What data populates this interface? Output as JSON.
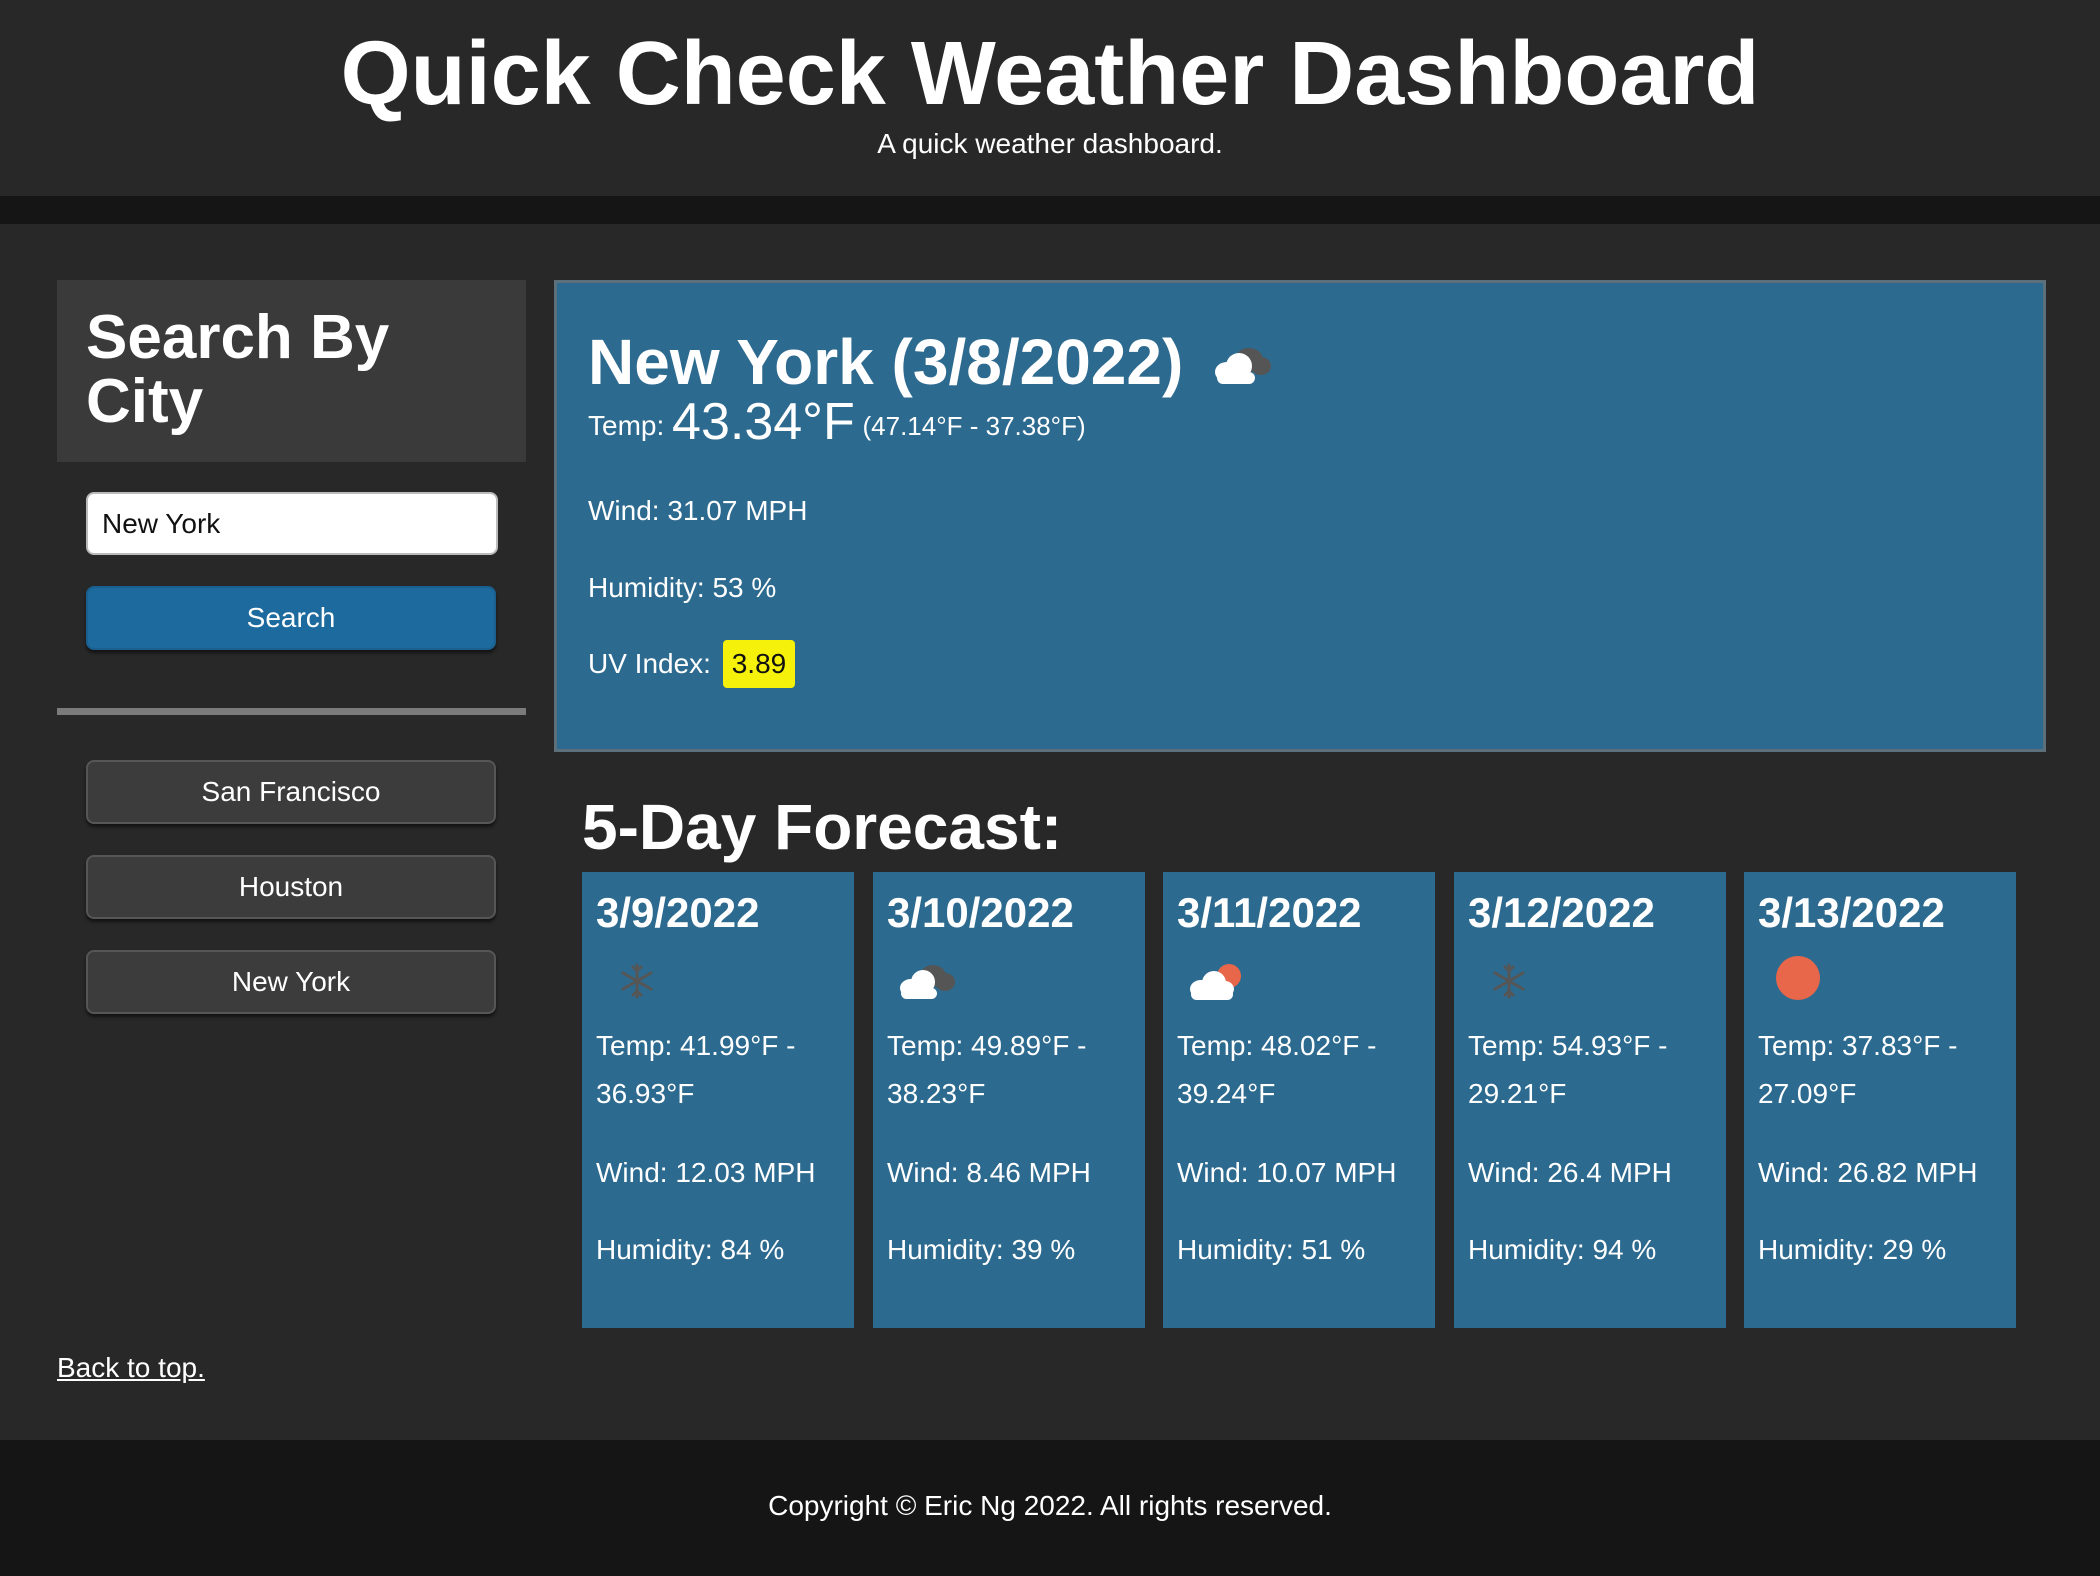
{
  "header": {
    "title": "Quick Check Weather Dashboard",
    "subtitle": "A quick weather dashboard."
  },
  "sidebar": {
    "heading": "Search By City",
    "search_value": "New York",
    "search_button": "Search",
    "history": [
      "San Francisco",
      "Houston",
      "New York"
    ],
    "back_to_top": "Back to top."
  },
  "current": {
    "title": "New York (3/8/2022)",
    "icon": "cloud-icon",
    "temp_label": "Temp:",
    "temp_value": "43.34°F",
    "temp_range": "(47.14°F - 37.38°F)",
    "wind": "Wind: 31.07 MPH",
    "humidity": "Humidity: 53 %",
    "uv_label": "UV Index:",
    "uv_value": "3.89",
    "uv_color": "#f5f10a"
  },
  "forecast": {
    "title": "5-Day Forecast:",
    "days": [
      {
        "date": "3/9/2022",
        "icon": "snow-icon",
        "temp_line1": "Temp: 41.99°F -",
        "temp_line2": "36.93°F",
        "wind": "Wind: 12.03 MPH",
        "humidity": "Humidity: 84 %"
      },
      {
        "date": "3/10/2022",
        "icon": "cloud-icon",
        "temp_line1": "Temp: 49.89°F -",
        "temp_line2": "38.23°F",
        "wind": "Wind: 8.46 MPH",
        "humidity": "Humidity: 39 %"
      },
      {
        "date": "3/11/2022",
        "icon": "partly-cloudy-icon",
        "temp_line1": "Temp: 48.02°F -",
        "temp_line2": "39.24°F",
        "wind": "Wind: 10.07 MPH",
        "humidity": "Humidity: 51 %"
      },
      {
        "date": "3/12/2022",
        "icon": "snow-icon",
        "temp_line1": "Temp: 54.93°F -",
        "temp_line2": "29.21°F",
        "wind": "Wind: 26.4 MPH",
        "humidity": "Humidity: 94 %"
      },
      {
        "date": "3/13/2022",
        "icon": "sun-icon",
        "temp_line1": "Temp: 37.83°F -",
        "temp_line2": "27.09°F",
        "wind": "Wind: 26.82 MPH",
        "humidity": "Humidity: 29 %"
      }
    ]
  },
  "footer": {
    "copyright": "Copyright © Eric Ng 2022. All rights reserved."
  },
  "colors": {
    "background": "#282828",
    "panel": "#2d6a8f",
    "search_button": "#1d6a9e",
    "uv_badge": "#f5f10a",
    "sun": "#e8664a"
  }
}
